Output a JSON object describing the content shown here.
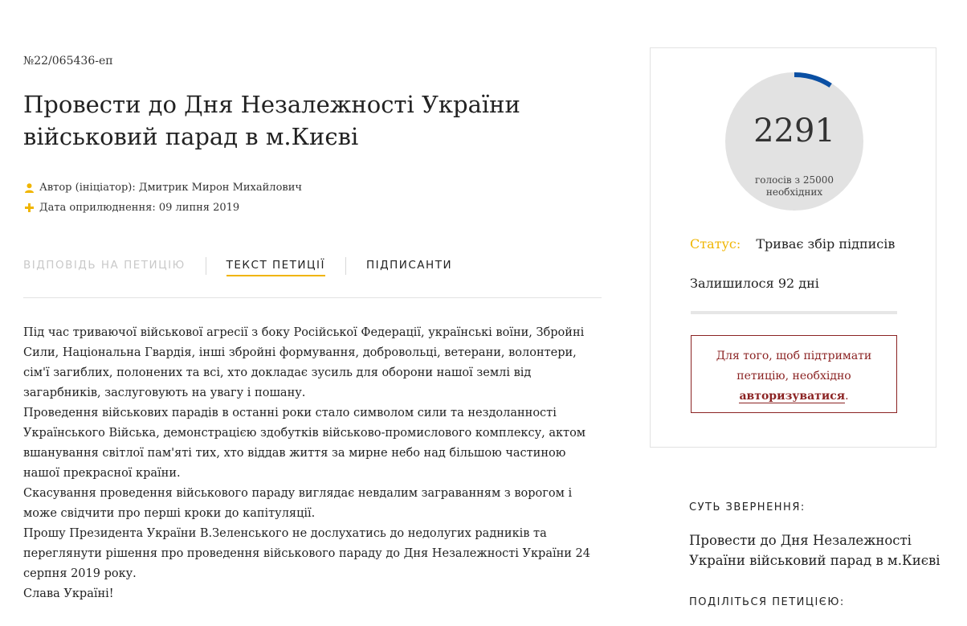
{
  "petition": {
    "number": "№22/065436-еп",
    "title": "Провести до Дня Незалежності України військовий парад в м.Києві",
    "author": "Автор (ініціатор): Дмитрик Мирон Михайлович",
    "date": "Дата оприлюднення: 09 липня 2019",
    "author_icon": "user-icon",
    "date_icon": "plus-icon"
  },
  "tabs": [
    {
      "label": "Відповідь на петицію",
      "state": "disabled"
    },
    {
      "label": "Текст петиції",
      "state": "active"
    },
    {
      "label": "Підписанти",
      "state": "normal"
    }
  ],
  "body": [
    "Під час триваючої військової агресії з боку Російської Федерації, українські воїни, Збройні Сили, Національна Гвардія, інші збройні формування, добровольці, ветерани, волонтери, сім'ї загиблих, полонених та всі, хто докладає зусиль для оборони нашої землі від загарбників, заслуговують на увагу і пошану.",
    "Проведення військових парадів в останні роки стало символом сили та нездоланності Українського Війська, демонстрацією здобутків військово-промислового комплексу, актом вшанування світлої пам'яті тих, хто віддав життя за мирне небо над більшою частиною нашої прекрасної країни.",
    "Скасування проведення військового параду виглядає невдалим загравниям з ворогом і може свідчити про перші кроки до капітуляції.",
    "Прошу Президента України В.Зеленського не дослухатись до недолугих радників та переглянути рішення про проведення військового параду до Дня Незалежності України 24 серпня 2019 року.",
    "Слава Україні!"
  ],
  "sidebar": {
    "votes": "2291",
    "votes_caption_1": "голосів з 25000",
    "votes_caption_2": "необхідних",
    "votes_current": 2291,
    "votes_needed": 25000,
    "status_label": "Статус:",
    "status_value": "Триває збір підписів",
    "remaining": "Залишилося 92 дні",
    "remaining_progress": 0,
    "auth_text_1": "Для того, щоб підтримати петицію, необхідно",
    "auth_link": "авторизуватися",
    "auth_text_2": ".",
    "essence_label": "Суть звернення:",
    "essence_text": "Провести до Дня Незалежності України військовий парад в м.Києві",
    "share_label": "Поділіться петицією:"
  },
  "colors": {
    "accent": "#f0b500",
    "progress": "#0a4fa3",
    "alert": "#8b2323",
    "circle_bg": "#e2e2e2"
  }
}
